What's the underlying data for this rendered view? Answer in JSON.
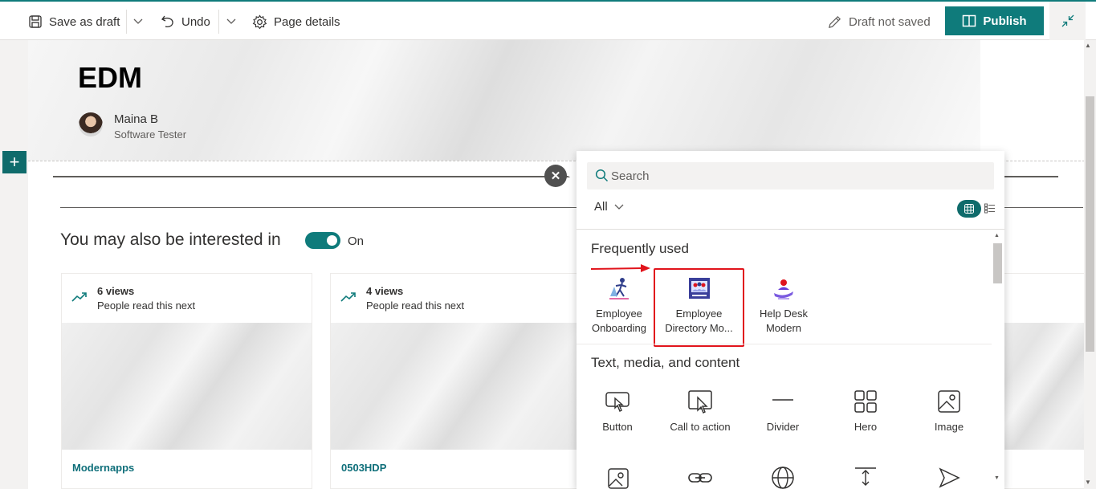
{
  "toolbar": {
    "save_label": "Save as draft",
    "undo_label": "Undo",
    "page_details_label": "Page details",
    "status_label": "Draft not saved",
    "publish_label": "Publish"
  },
  "hero": {
    "title": "EDM",
    "author_name": "Maina B",
    "author_role": "Software Tester"
  },
  "recommendations": {
    "heading": "You may also be interested in",
    "toggle_label": "On",
    "cards": [
      {
        "views": "6 views",
        "subtitle": "People read this next",
        "link": "Modernapps"
      },
      {
        "views": "4 views",
        "subtitle": "People read this next",
        "link": "0503HDP"
      }
    ]
  },
  "toolbox": {
    "search_placeholder": "Search",
    "filter_label": "All",
    "frequently_used_title": "Frequently used",
    "frequently_used": [
      {
        "line1": "Employee",
        "line2": "Onboarding",
        "icon": "onboarding-icon"
      },
      {
        "line1": "Employee",
        "line2": "Directory Mo...",
        "icon": "directory-icon"
      },
      {
        "line1": "Help Desk",
        "line2": "Modern",
        "icon": "helpdesk-icon"
      }
    ],
    "text_media_title": "Text, media, and content",
    "text_media": [
      {
        "label": "Button",
        "icon": "button-icon"
      },
      {
        "label": "Call to action",
        "icon": "call-to-action-icon"
      },
      {
        "label": "Divider",
        "icon": "divider-icon"
      },
      {
        "label": "Hero",
        "icon": "hero-icon"
      },
      {
        "label": "Image",
        "icon": "image-icon"
      }
    ]
  },
  "colors": {
    "accent": "#0f7b7b",
    "highlight": "#e1141c"
  }
}
